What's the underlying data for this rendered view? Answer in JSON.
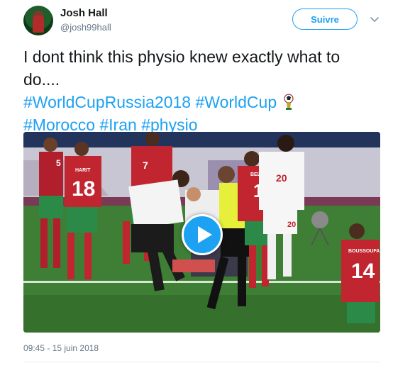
{
  "tweet": {
    "author": {
      "display_name": "Josh Hall",
      "handle": "@josh99hall",
      "avatar_icon": "user-avatar"
    },
    "follow_label": "Suivre",
    "text_line_1": "I dont think this physio knew exactly what to",
    "text_line_2": "do....",
    "hashtags_line_1": [
      "#WorldCupRussia2018",
      "#WorldCup"
    ],
    "hashtags_line_2": [
      "#Morocco",
      "#Iran",
      "#physio"
    ],
    "timestamp": "09:45 - 15 juin 2018",
    "media": {
      "type": "video",
      "play_icon": "play-icon",
      "jersey_numbers": [
        "5",
        "18",
        "7",
        "10",
        "20",
        "20",
        "14"
      ],
      "jersey_names": [
        "HARIT",
        "BELHANDA",
        "BOUSSOUFA"
      ]
    }
  },
  "colors": {
    "link": "#1da1f2",
    "text": "#14171a",
    "secondary": "#657786"
  }
}
